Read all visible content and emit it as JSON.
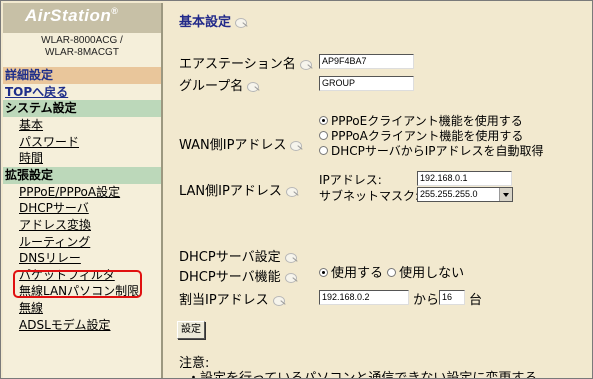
{
  "sidebar": {
    "logo_text": "AirStation",
    "model_line1": "WLAR-8000ACG /",
    "model_line2": "WLAR-8MACGT",
    "detail_header": "詳細設定",
    "top_link": "TOPへ戻る",
    "system_header": "システム設定",
    "system_items": [
      "基本",
      "パスワード",
      "時間"
    ],
    "extended_header": "拡張設定",
    "extended_items": [
      "PPPoE/PPPoA設定",
      "DHCPサーバ",
      "アドレス変換",
      "ルーティング",
      "DNSリレー",
      "パケットフィルタ",
      "無線LANパソコン制限",
      "無線",
      "ADSLモデム設定"
    ],
    "highlighted_item": "パケットフィルタ",
    "highlight_color": "#e01010"
  },
  "main": {
    "title": "基本設定",
    "station_name_label": "エアステーション名",
    "station_name_value": "AP9F4BA7",
    "group_name_label": "グループ名",
    "group_name_value": "GROUP",
    "wan_label": "WAN側IPアドレス",
    "wan_options": [
      "PPPoEクライアント機能を使用する",
      "PPPoAクライアント機能を使用する",
      "DHCPサーバからIPアドレスを自動取得"
    ],
    "wan_selected": "PPPoEクライアント機能を使用する",
    "lan_label": "LAN側IPアドレス",
    "lan_ip_label": "IPアドレス:",
    "lan_ip_value": "192.168.0.1",
    "subnet_label": "サブネットマスク:",
    "subnet_value": "255.255.255.0",
    "dhcp_header": "DHCPサーバ設定",
    "dhcp_func_label": "DHCPサーバ機能",
    "dhcp_on": "使用する",
    "dhcp_off": "使用しない",
    "dhcp_selected": "使用する",
    "assign_label": "割当IPアドレス",
    "assign_start": "192.168.0.2",
    "assign_from": "から",
    "assign_count": "16",
    "assign_unit": "台",
    "apply_button": "設定",
    "note_title": "注意:",
    "note_item": "・設定を行っているパソコンと通信できない設定に変更する"
  },
  "colors": {
    "sidebar_bg": "#f5efda",
    "main_bg": "#f2e9cf",
    "orange_header": "#e9c69b",
    "green_header": "#bcd8ba",
    "title_blue": "#222a8a"
  }
}
